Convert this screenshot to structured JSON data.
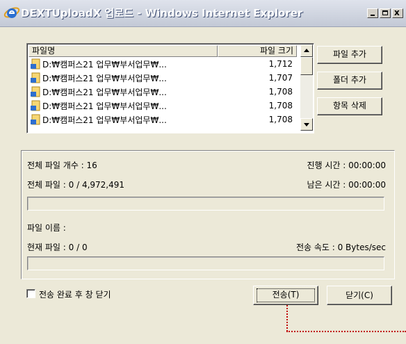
{
  "window": {
    "title": "DEXTUploadX 업로드 - Windows Internet Explorer",
    "icon": "ie-icon",
    "controls": [
      "minimize",
      "maximize",
      "close"
    ],
    "close_glyph": "x"
  },
  "file_list": {
    "columns": {
      "name": "파일명",
      "size": "파일 크기"
    },
    "rows": [
      {
        "name": "D:₩캠퍼스21 업무₩부서업무₩...",
        "size": "1,712"
      },
      {
        "name": "D:₩캠퍼스21 업무₩부서업무₩...",
        "size": "1,707"
      },
      {
        "name": "D:₩캠퍼스21 업무₩부서업무₩...",
        "size": "1,708"
      },
      {
        "name": "D:₩캠퍼스21 업무₩부서업무₩...",
        "size": "1,708"
      },
      {
        "name": "D:₩캠퍼스21 업무₩부서업무₩...",
        "size": "1,708"
      }
    ]
  },
  "side_buttons": {
    "add_file": "파일 추가",
    "add_folder": "폴더 추가",
    "delete_item": "항목 삭제"
  },
  "status": {
    "total_count": "전체 파일 개수 : 16",
    "elapsed": "진행 시간 : 00:00:00",
    "total_bytes": "전체 파일 : 0 / 4,972,491",
    "remaining": "남은 시간 : 00:00:00",
    "total_progress": 0,
    "file_name": "파일 이름 :",
    "current_file": "현재 파일 : 0 / 0",
    "speed": "전송 속도 : 0 Bytes/sec",
    "file_progress": 0
  },
  "footer": {
    "close_after_label": "전송 완료 후 창 닫기",
    "close_after_checked": false,
    "send_label": "전송(T)",
    "close_label": "닫기(C)"
  },
  "colors": {
    "annotation": "#c00000",
    "title_text": "#ffffff",
    "face": "#ece9d8"
  }
}
